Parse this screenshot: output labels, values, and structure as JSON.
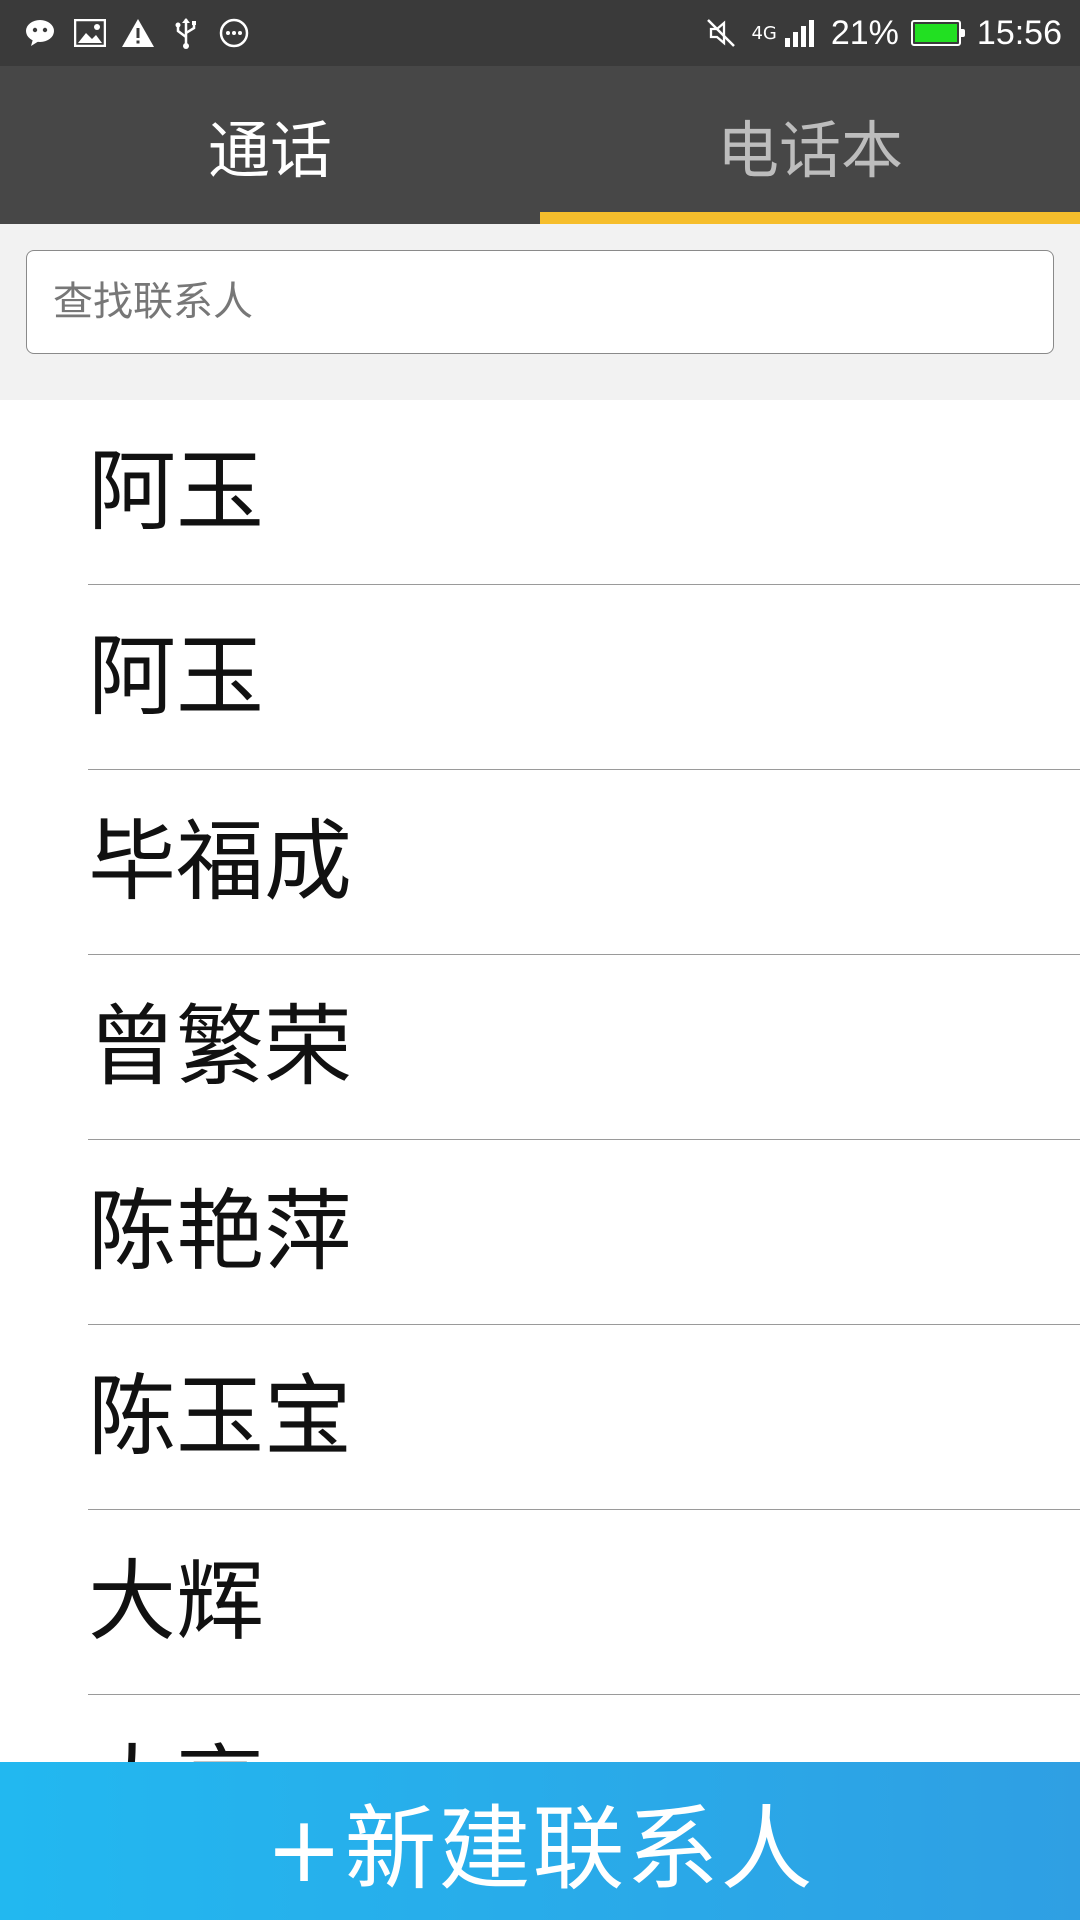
{
  "status_bar": {
    "left_icons": [
      "wechat-icon",
      "image-icon",
      "warning-icon",
      "usb-icon",
      "more-icon"
    ],
    "right_icons": [
      "mute-icon",
      "signal-icon"
    ],
    "network": "4G",
    "battery_percent": "21%",
    "battery_level": 0.21,
    "time": "15:56",
    "battery_color": "#22e022"
  },
  "tabs": [
    {
      "label": "通话",
      "active": false
    },
    {
      "label": "电话本",
      "active": true
    }
  ],
  "tab_indicator_color": "#f6be2c",
  "search": {
    "placeholder": "查找联系人",
    "value": ""
  },
  "contacts": [
    {
      "name": "阿玉"
    },
    {
      "name": "阿玉"
    },
    {
      "name": "毕福成"
    },
    {
      "name": "曾繁荣"
    },
    {
      "name": "陈艳萍"
    },
    {
      "name": "陈玉宝"
    },
    {
      "name": "大辉"
    },
    {
      "name": "大亮"
    }
  ],
  "new_contact_button": {
    "label": "+新建联系人",
    "color": "#2aaae8"
  }
}
